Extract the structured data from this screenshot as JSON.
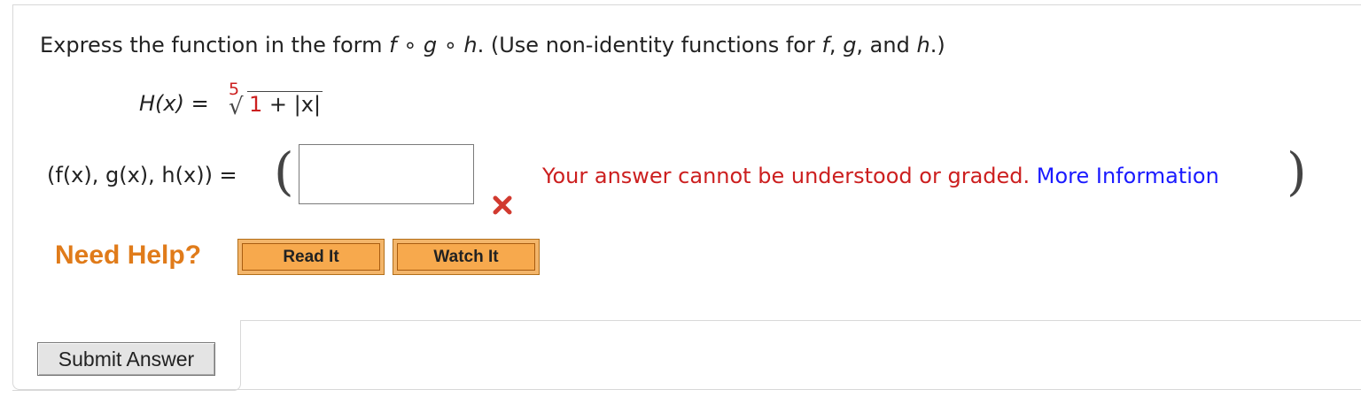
{
  "question": {
    "prefix": "Express the function in the form ",
    "form_f": "f",
    "form_circ1": " ∘ ",
    "form_g": "g",
    "form_circ2": " ∘ ",
    "form_h": "h",
    "suffix_1": ".  (Use non-identity functions for ",
    "suffix_f": "f",
    "suffix_2": ", ",
    "suffix_g": "g",
    "suffix_3": ", and ",
    "suffix_h": "h",
    "suffix_4": ".)"
  },
  "formula": {
    "lhs": "H(x)",
    "equals": " = ",
    "root_index": "5",
    "radicand_one": "1",
    "radicand_rest": " + |x|"
  },
  "answer": {
    "lhs": "(f(x), g(x), h(x)) = ",
    "paren_open": "(",
    "paren_close": ")",
    "input_value": "",
    "error_text": "Your answer cannot be understood or graded. ",
    "more_info_link": "More Information",
    "status_icon": "x-mark-icon",
    "error_color": "#cc1f1f",
    "link_color": "#1a1aff"
  },
  "help": {
    "label": "Need Help?",
    "read_it": "Read It",
    "watch_it": "Watch It",
    "accent": "#e07b1a"
  },
  "submit": {
    "label": "Submit Answer"
  }
}
